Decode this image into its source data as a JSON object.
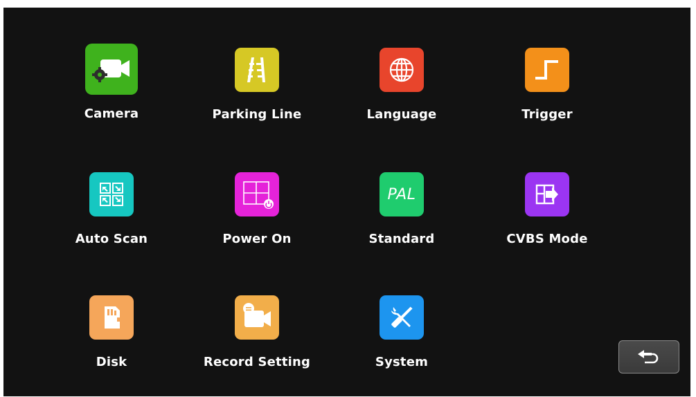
{
  "menu": {
    "items": [
      {
        "id": "camera",
        "label": "Camera",
        "icon": "camera-settings-icon",
        "color": "#3fb21d"
      },
      {
        "id": "parking-line",
        "label": "Parking Line",
        "icon": "parking-line-icon",
        "color": "#d6c825"
      },
      {
        "id": "language",
        "label": "Language",
        "icon": "globe-icon",
        "color": "#e8452c"
      },
      {
        "id": "trigger",
        "label": "Trigger",
        "icon": "trigger-step-icon",
        "color": "#f3901a"
      },
      {
        "id": "auto-scan",
        "label": "Auto Scan",
        "icon": "auto-scan-icon",
        "color": "#16c7c1"
      },
      {
        "id": "power-on",
        "label": "Power On",
        "icon": "power-on-icon",
        "color": "#e523d9"
      },
      {
        "id": "standard",
        "label": "Standard",
        "icon": "pal-icon",
        "color": "#1fcc6e",
        "icon_text": "PAL"
      },
      {
        "id": "cvbs-mode",
        "label": "CVBS Mode",
        "icon": "cvbs-mode-icon",
        "color": "#9b35f2"
      },
      {
        "id": "disk",
        "label": "Disk",
        "icon": "sd-card-icon",
        "color": "#f5a65a"
      },
      {
        "id": "record-setting",
        "label": "Record Setting",
        "icon": "record-camera-icon",
        "color": "#f2ae4a"
      },
      {
        "id": "system",
        "label": "System",
        "icon": "tools-icon",
        "color": "#1d95ef"
      }
    ]
  },
  "back_button": {
    "icon": "back-arrow-icon"
  }
}
